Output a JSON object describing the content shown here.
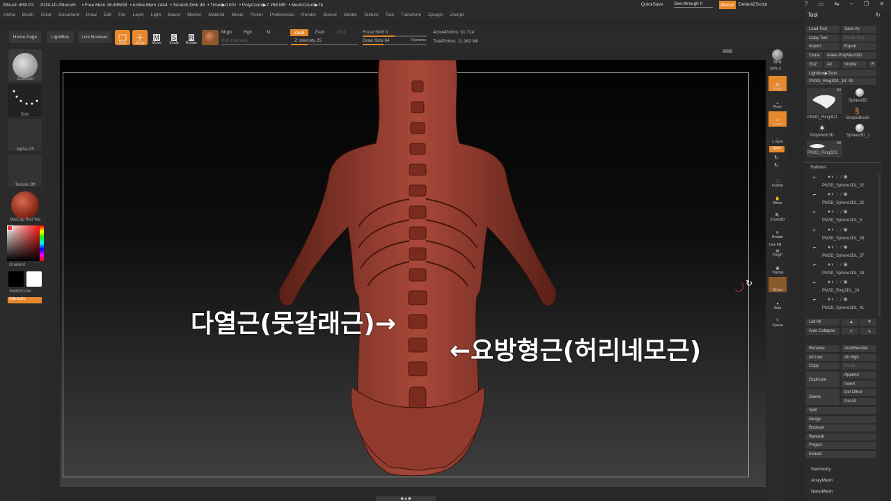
{
  "app": {
    "title": "ZBrush 4R8 P2",
    "project": "2019-10-25torso5",
    "free_mem": "• Free Mem 26.495GB",
    "active_mem": "• Active Mem 1444",
    "scratch_disk": "• Scratch Disk 48",
    "timer": "• Timer▶0.001",
    "poly_count": "• PolyCount▶7.256 MP",
    "mesh_count": "• MeshCount▶74",
    "quicksave": "QuickSave",
    "see_through": "See-through  0",
    "menus": "Menus",
    "default_script": "DefaultZScript"
  },
  "menu": [
    "Alpha",
    "Brush",
    "Color",
    "Document",
    "Draw",
    "Edit",
    "File",
    "Layer",
    "Light",
    "Macro",
    "Marker",
    "Material",
    "Movie",
    "Picker",
    "Preferences",
    "Render",
    "Stencil",
    "Stroke",
    "Texture",
    "Tool",
    "Transform",
    "Zplugin",
    "Zscript"
  ],
  "toolbar": {
    "home_page": "Home Page",
    "lightbox": "LightBox",
    "live_boolean": "Live Boolean",
    "edit": "Edit",
    "draw": "Draw",
    "move": "Move",
    "scale": "Scale",
    "rotate": "Rotate",
    "mrgb": "Mrgb",
    "rgb": "Rgb",
    "m": "M",
    "rgb_intensity": "Rgb Intensity",
    "zadd": "Zadd",
    "zsub": "Zsub",
    "zcut": "Zcut",
    "z_intensity": "Z Intensity 25",
    "z_intensity_value": 25,
    "focal_shift": "Focal Shift 0",
    "draw_size": "Draw Size 64",
    "dynamic": "Dynamic",
    "active_points": "ActivePoints: 31,714",
    "total_points": "TotalPoints: 11.342 Mil"
  },
  "left_shelf": {
    "brush": "Standard",
    "stroke": "Dots",
    "alpha": "Alpha Off",
    "texture": "Texture Off",
    "material": "MatCap Red Wa",
    "gradient": "Gradient",
    "switch_color": "SwitchColor",
    "alternate": "Alternate"
  },
  "annotations": {
    "left": "다열근(뭇갈래근)→",
    "right": "←요방형근(허리네모근)"
  },
  "right_shelf": {
    "bpr": "BPR",
    "spix": "SPix 3",
    "persp": "Persp",
    "floor": "Floor",
    "local": "Local",
    "lsym": "L.Sym",
    "xyz": "Qxyz",
    "frame": "Frame",
    "move": "Move",
    "zoom3d": "Zoom3D",
    "rotate": "Rotate",
    "polyf": "PolyF",
    "transp": "Transp",
    "ghost": "Ghost",
    "solo": "Solo",
    "xpose": "Xpose",
    "linefill": "Line Fill"
  },
  "tool_panel": {
    "title": "Tool",
    "load_tool": "Load Tool",
    "save_as": "Save As",
    "copy_tool": "Copy Tool",
    "paste_tool": "Paste Tool",
    "import": "Import",
    "export": "Export",
    "clone": "Clone",
    "make_polymesh": "Make PolyMesh3D",
    "goz": "GoZ",
    "all": "All",
    "visible": "Visible",
    "r": "R",
    "lightbox_tools": "Lightbox▶Tools",
    "current_tool": "PM3D_Ring3D1_18. 49",
    "tools": [
      {
        "name": "PM3D_Ring3D1",
        "count": "90"
      },
      {
        "name": "Sphere3D",
        "count": ""
      },
      {
        "name": "SimpleBrush",
        "count": ""
      },
      {
        "name": "PolyMesh3D",
        "count": ""
      },
      {
        "name": "Sphere3D_1",
        "count": ""
      },
      {
        "name": "PM3D_Ring3D1",
        "count": "90"
      }
    ]
  },
  "subtool": {
    "title": "Subtool",
    "items": [
      "PM3D_Sphere3D1_32",
      "PM3D_Sphere3D1_32",
      "PM3D_Sphere3D1_9",
      "PM3D_Sphere3D1_39",
      "PM3D_Sphere3D1_37",
      "PM3D_Sphere3D1_34",
      "PM3D_Ring3D1_24",
      "PM3D_Sphere3D1_41"
    ],
    "list_all": "List All",
    "auto_collapse": "Auto Collapse",
    "rename": "Rename",
    "auto_reorder": "AutoReorder",
    "all_low": "All Low",
    "all_high": "All High",
    "copy": "Copy",
    "paste": "Paste",
    "duplicate": "Duplicate",
    "append": "Append",
    "insert": "Insert",
    "delete": "Delete",
    "del_other": "Del Other",
    "del_all": "Del All",
    "split": "Split",
    "merge": "Merge",
    "boolean": "Boolean",
    "remesh": "Remesh",
    "project": "Project",
    "extract": "Extract"
  },
  "panels": [
    "Geometry",
    "ArrayMesh",
    "NanoMesh"
  ],
  "colors": {
    "accent": "#e8882c",
    "model": "#8f3a2c",
    "canvas_bg": "#050505"
  }
}
